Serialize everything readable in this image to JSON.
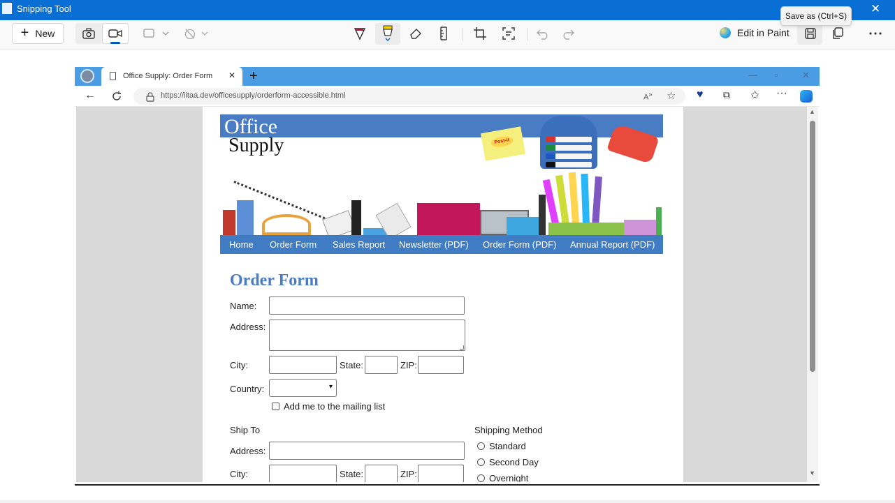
{
  "snipping_tool": {
    "title": "Snipping Tool",
    "new_label": "New",
    "edit_in_paint_label": "Edit in Paint",
    "tooltip": "Save as (Ctrl+S)",
    "close_glyph": "✕"
  },
  "browser": {
    "tab_title": "Office Supply: Order Form",
    "url": "https://iitaa.dev/officesupply/orderform-accessible.html"
  },
  "site": {
    "logo_line1": "Office",
    "logo_line2": "Supply",
    "postit_brand": "Post-it",
    "nav": [
      "Home",
      "Order Form",
      "Sales Report",
      "Newsletter (PDF)",
      "Order Form (PDF)",
      "Annual Report (PDF)"
    ]
  },
  "form": {
    "title": "Order Form",
    "name_label": "Name:",
    "address_label": "Address:",
    "city_label": "City:",
    "state_label": "State:",
    "zip_label": "ZIP:",
    "country_label": "Country:",
    "mailing_list_label": "Add me to the mailing list",
    "ship_to_heading": "Ship To",
    "ship_address_label": "Address:",
    "ship_city_label": "City:",
    "ship_state_label": "State:",
    "ship_zip_label": "ZIP:",
    "shipping_method_heading": "Shipping Method",
    "shipping_options": [
      "Standard",
      "Second Day",
      "Overnight"
    ]
  },
  "colors": {
    "title_bar": "#0a6fd4",
    "tab_strip": "#4a9de2",
    "site_blue": "#4a7cc4"
  }
}
